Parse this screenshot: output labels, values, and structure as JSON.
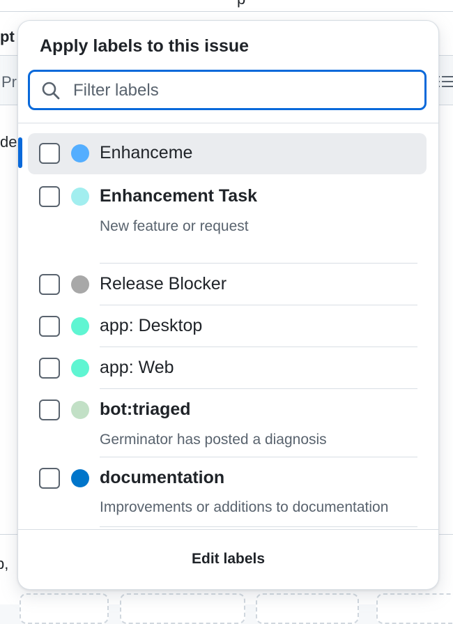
{
  "background": {
    "fragments": {
      "top_right": "p",
      "left_bold": "pt",
      "left_tab": "Pr",
      "left_text": "de",
      "left_bottom": "p,"
    }
  },
  "popover": {
    "title": "Apply labels to this issue",
    "filter": {
      "placeholder": "Filter labels",
      "value": "",
      "icon": "search-icon"
    },
    "labels": [
      {
        "name": "Enhanceme",
        "description": "",
        "color": "#54aeff",
        "checked": false,
        "active": true,
        "bold": false
      },
      {
        "name": "Enhancement Task",
        "description": "New feature or request",
        "color": "#a2eeef",
        "checked": false,
        "active": false,
        "bold": true
      },
      {
        "name": "Release Blocker",
        "description": "",
        "color": "#a8a8a8",
        "checked": false,
        "active": false,
        "bold": false
      },
      {
        "name": "app: Desktop",
        "description": "",
        "color": "#5ff5d2",
        "checked": false,
        "active": false,
        "bold": false
      },
      {
        "name": "app: Web",
        "description": "",
        "color": "#5ff5d2",
        "checked": false,
        "active": false,
        "bold": false
      },
      {
        "name": "bot:triaged",
        "description": "Germinator has posted a diagnosis",
        "color": "#c2e0c6",
        "checked": false,
        "active": false,
        "bold": true
      },
      {
        "name": "documentation",
        "description": "Improvements or additions to documentation",
        "color": "#0075ca",
        "checked": false,
        "active": false,
        "bold": true
      }
    ],
    "footer_link": "Edit labels"
  },
  "colors": {
    "accent": "#0969da",
    "border": "#d8dee4",
    "muted_text": "#59636e",
    "active_row": "#eaecef"
  }
}
